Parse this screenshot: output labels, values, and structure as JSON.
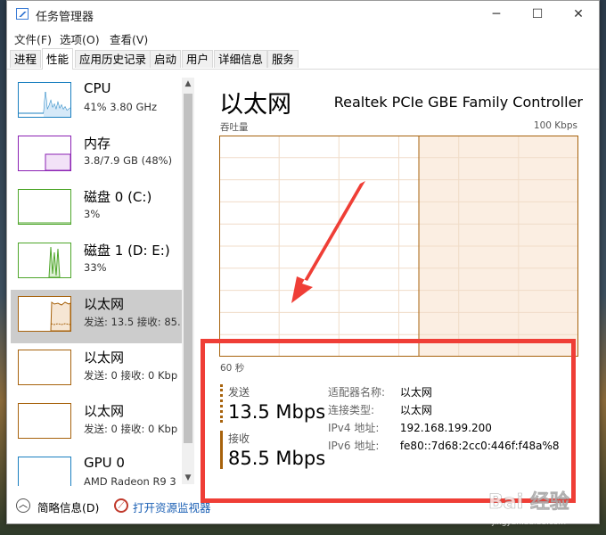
{
  "window": {
    "title": "任务管理器",
    "minimize": "─",
    "maximize": "☐",
    "close": "✕"
  },
  "menu": [
    "文件(F)",
    "选项(O)",
    "查看(V)"
  ],
  "tabs": [
    "进程",
    "性能",
    "应用历史记录",
    "启动",
    "用户",
    "详细信息",
    "服务"
  ],
  "active_tab": "性能",
  "sidebar": {
    "items": [
      {
        "name": "CPU",
        "sub": "41%  3.80 GHz",
        "color": "#1a7fc0"
      },
      {
        "name": "内存",
        "sub": "3.8/7.9 GB (48%)",
        "color": "#8b21b3"
      },
      {
        "name": "磁盘 0 (C:)",
        "sub": "3%",
        "color": "#4ea62a"
      },
      {
        "name": "磁盘 1 (D: E:)",
        "sub": "33%",
        "color": "#4ea62a"
      },
      {
        "name": "以太网",
        "sub": "发送: 13.5  接收: 85.",
        "color": "#a7620c"
      },
      {
        "name": "以太网",
        "sub": "发送: 0  接收: 0 Kbp",
        "color": "#a7620c"
      },
      {
        "name": "以太网",
        "sub": "发送: 0  接收: 0 Kbp",
        "color": "#a7620c"
      },
      {
        "name": "GPU 0",
        "sub": "AMD Radeon R9 3",
        "color": "#1a7fc0"
      }
    ]
  },
  "main": {
    "title": "以太网",
    "adapter": "Realtek PCIe GBE Family Controller",
    "axis_label": "吞吐量",
    "axis_max": "100 Kbps",
    "time_label": "60 秒",
    "graph_color": "#a7620c",
    "send": {
      "label": "发送",
      "value": "13.5 Mbps"
    },
    "receive": {
      "label": "接收",
      "value": "85.5 Mbps"
    },
    "info": [
      {
        "key": "适配器名称:",
        "value": "以太网"
      },
      {
        "key": "连接类型:",
        "value": "以太网"
      },
      {
        "key": "IPv4 地址:",
        "value": "192.168.199.200"
      },
      {
        "key": "IPv6 地址:",
        "value": "fe80::7d68:2cc0:446f:f48a%8"
      }
    ]
  },
  "footer": {
    "brief": "简略信息(D)",
    "monitor": "打开资源监视器"
  },
  "annotation_color": "#ef3e36",
  "watermark": "Bai 经验"
}
